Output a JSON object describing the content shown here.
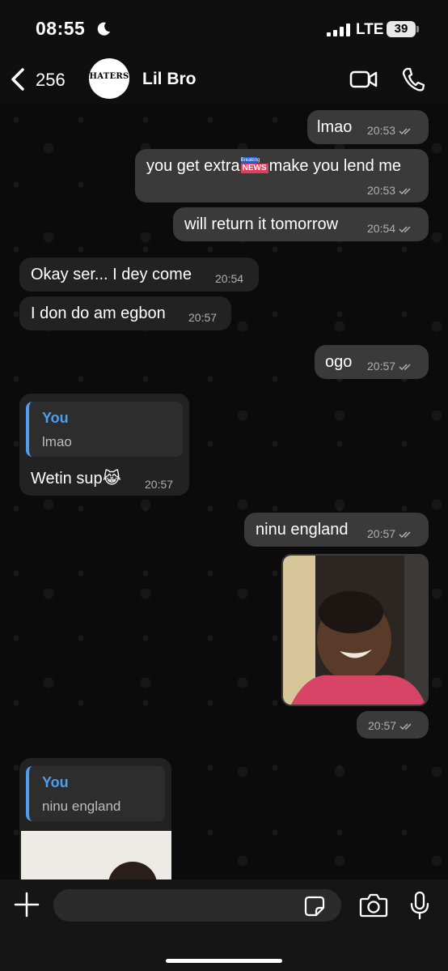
{
  "status_bar": {
    "time": "08:55",
    "network": "LTE",
    "battery": "39"
  },
  "header": {
    "back_count": "256",
    "avatar_text": "HATERS",
    "contact_name": "Lil Bro"
  },
  "messages": [
    {
      "direction": "out",
      "text": "lmao",
      "time": "20:53",
      "read": true
    },
    {
      "direction": "out",
      "text_before": "you get extra",
      "emoji": {
        "top": "Breaking",
        "bottom": "NEWS"
      },
      "text_after": "make you lend me",
      "time": "20:53",
      "read": true
    },
    {
      "direction": "out",
      "text": "will return it tomorrow",
      "time": "20:54",
      "read": true
    },
    {
      "direction": "in",
      "text": "Okay ser... I dey come",
      "time": "20:54"
    },
    {
      "direction": "in",
      "text": "I don do am egbon",
      "time": "20:57"
    },
    {
      "direction": "out",
      "text": "ogo",
      "time": "20:57",
      "read": true
    },
    {
      "direction": "in",
      "reply_to": {
        "author": "You",
        "text": "lmao"
      },
      "text": "Wetin sup😹",
      "time": "20:57"
    },
    {
      "direction": "out",
      "text": "ninu england",
      "time": "20:57",
      "read": true
    },
    {
      "direction": "out",
      "type": "image",
      "time": "20:57",
      "read": true
    },
    {
      "direction": "in",
      "reply_to": {
        "author": "You",
        "text": "ninu england"
      },
      "type": "image"
    }
  ],
  "composer": {
    "placeholder": ""
  },
  "colors": {
    "outgoing_bubble": "#3a3a3a",
    "incoming_bubble": "#222222",
    "reply_accent": "#4b9ef2",
    "meta_text": "#b0b0b0"
  },
  "icons": [
    "back-chevron-icon",
    "video-call-icon",
    "phone-icon",
    "plus-icon",
    "sticker-icon",
    "camera-icon",
    "mic-icon",
    "chevron-down-icon",
    "double-check-icon",
    "moon-icon"
  ]
}
